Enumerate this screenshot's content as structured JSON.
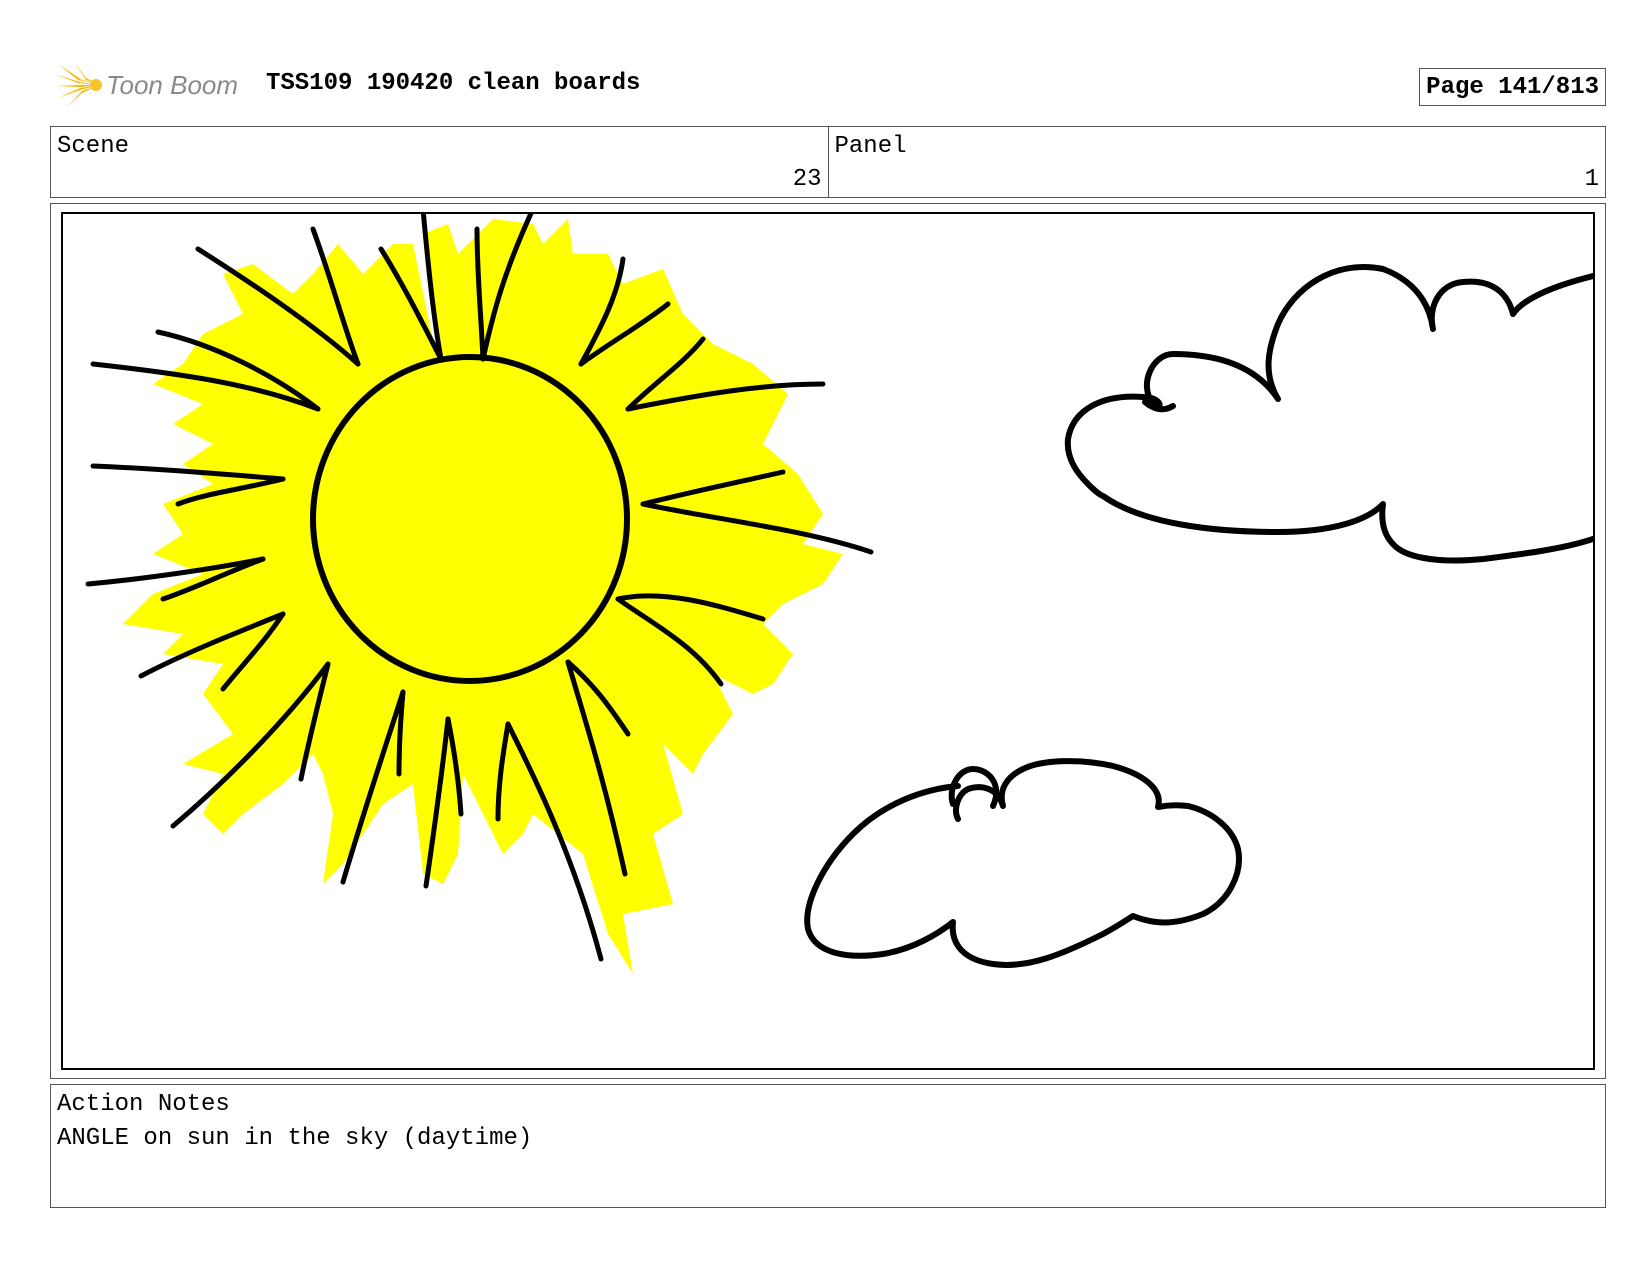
{
  "header": {
    "logo_text": "Toon Boom",
    "title": "TSS109 190420 clean boards",
    "page_indicator": "Page 141/813"
  },
  "info": {
    "scene_label": "Scene",
    "scene_value": "23",
    "panel_label": "Panel",
    "panel_value": "1"
  },
  "panel_image": {
    "icons": [
      "sun-drawing",
      "cloud-drawing"
    ],
    "colors": {
      "sun_fill": "#ffff00",
      "ink": "#000000"
    }
  },
  "notes": {
    "label": "Action Notes",
    "text": "ANGLE on sun in the sky (daytime)"
  }
}
